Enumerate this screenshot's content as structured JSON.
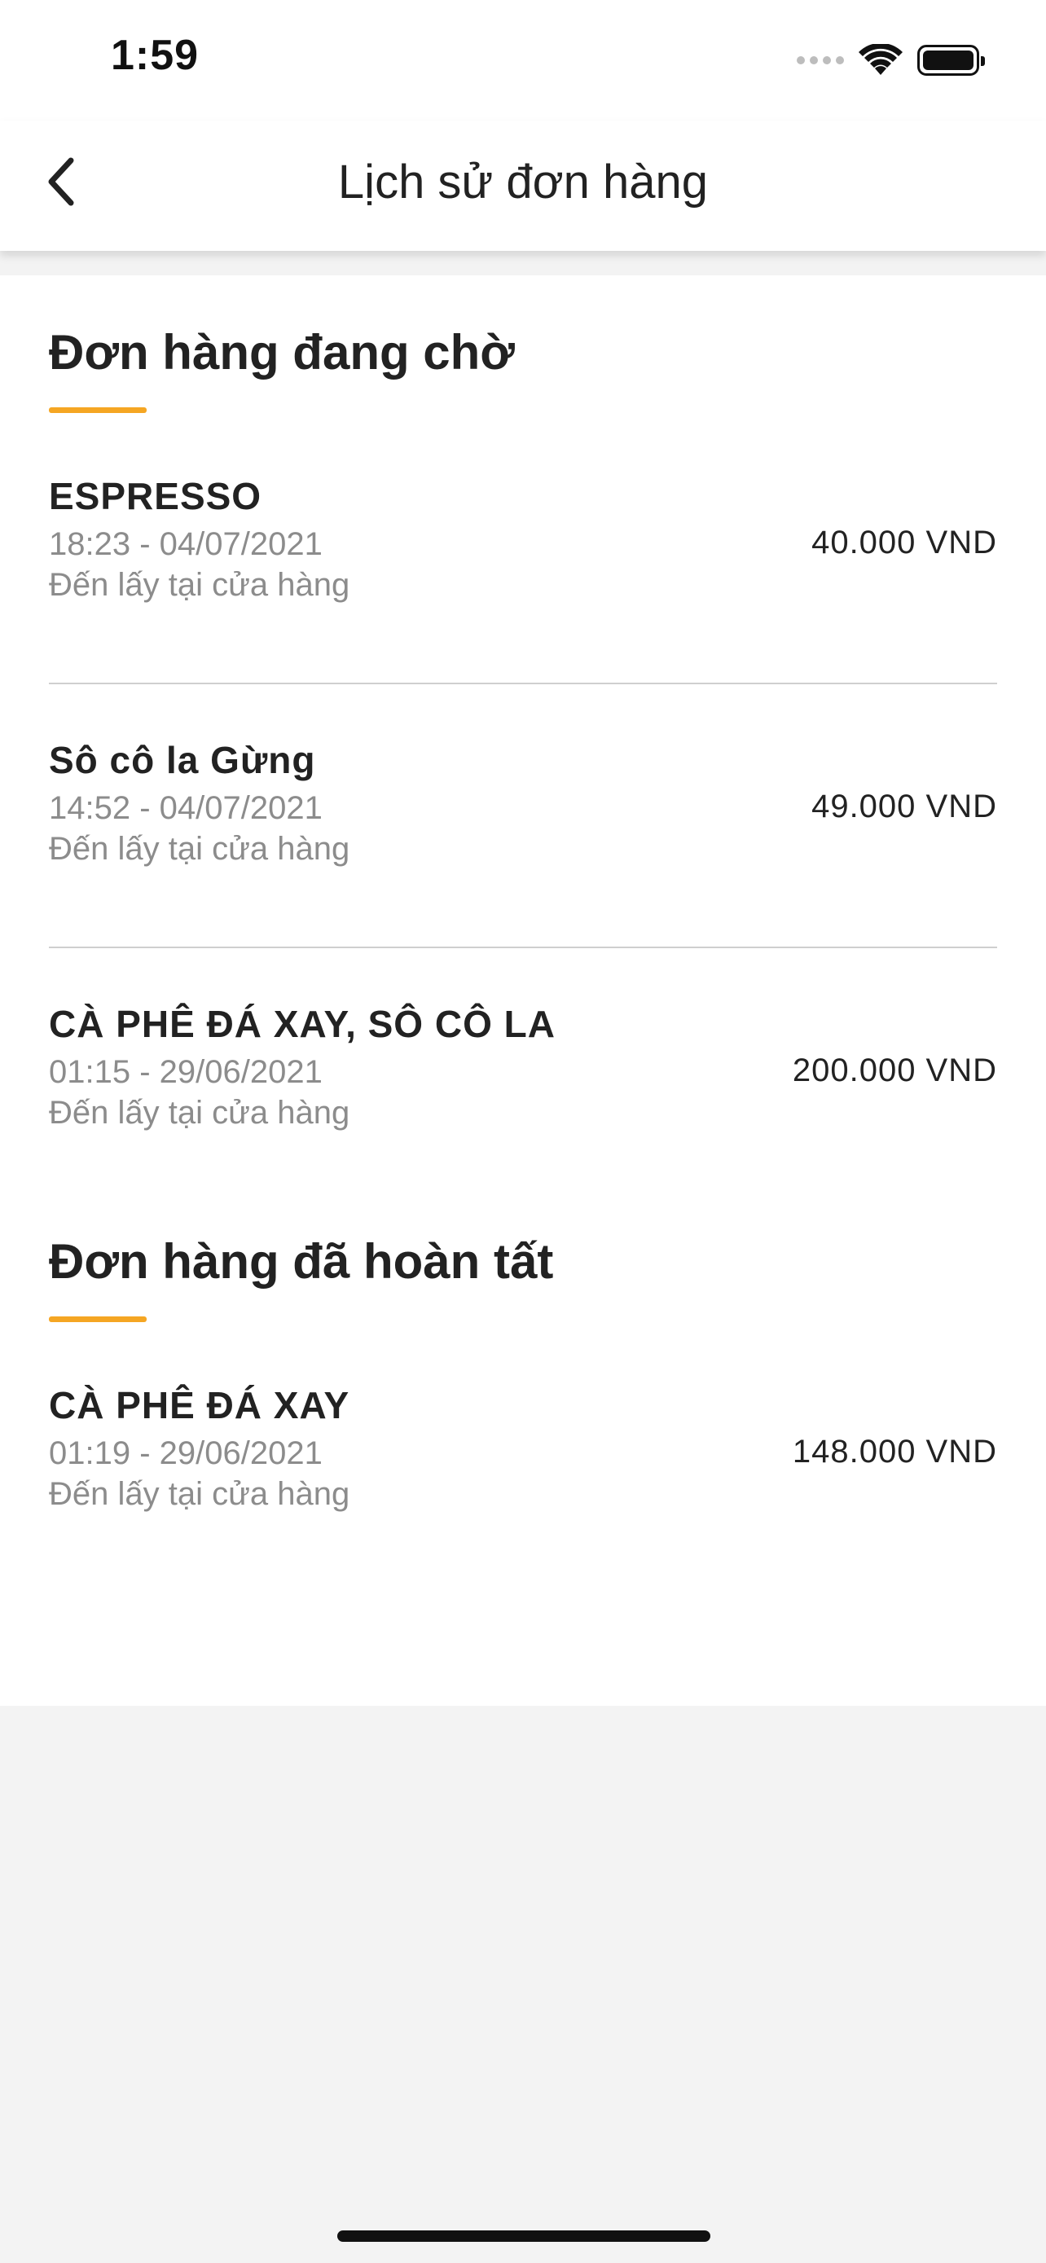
{
  "status_bar": {
    "time": "1:59"
  },
  "nav": {
    "back_icon": "chevron-left-icon",
    "title": "Lịch sử đơn hàng"
  },
  "pending": {
    "title": "Đơn hàng đang chờ",
    "accent_color": "#f5a623",
    "orders": [
      {
        "name": "ESPRESSO",
        "time": "18:23 - 04/07/2021",
        "method": "Đến lấy tại cửa hàng",
        "price": "40.000 VND"
      },
      {
        "name": "Sô cô la Gừng",
        "time": "14:52 - 04/07/2021",
        "method": "Đến lấy tại cửa hàng",
        "price": "49.000 VND"
      },
      {
        "name": "CÀ PHÊ ĐÁ XAY, SÔ CÔ LA",
        "time": "01:15 - 29/06/2021",
        "method": "Đến lấy tại cửa hàng",
        "price": "200.000 VND"
      }
    ]
  },
  "completed": {
    "title": "Đơn hàng đã hoàn tất",
    "orders": [
      {
        "name": "CÀ PHÊ ĐÁ XAY",
        "time": "01:19 - 29/06/2021",
        "method": "Đến lấy tại cửa hàng",
        "price": "148.000 VND"
      }
    ]
  }
}
